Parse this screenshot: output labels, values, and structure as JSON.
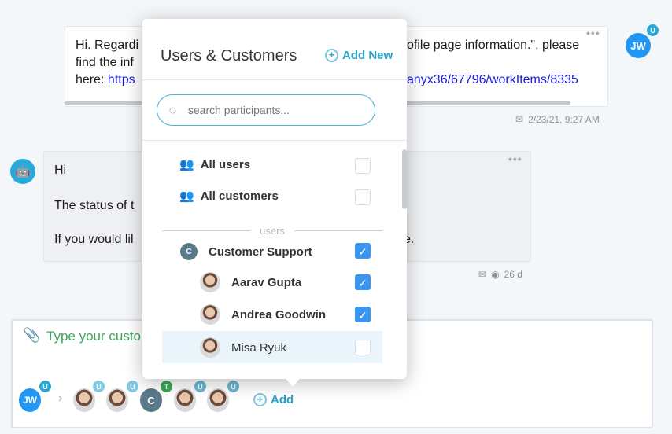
{
  "messages": [
    {
      "lines_left": [
        "Hi. Regardi",
        "find the inf",
        "here: "
      ],
      "link_left": "https",
      "lines_right": [
        "ofile page information.\", please",
        "",
        "anyx36/67796/workItems/8335"
      ],
      "timestamp": "2/23/21, 9:27 AM",
      "avatar": "JW",
      "badge": "U"
    },
    {
      "lines_left": [
        "Hi",
        "The status of t",
        "If you would lil"
      ],
      "right_fragment": "e.",
      "age": "26 d"
    }
  ],
  "composer": {
    "placeholder": "Type your custo",
    "participants": [
      {
        "initials": "JW",
        "badge": "U"
      },
      {
        "badge": "U"
      },
      {
        "badge": "U"
      },
      {
        "initials": "C",
        "badge": "T"
      },
      {
        "badge": "U"
      },
      {
        "badge": "U"
      }
    ],
    "add_label": "Add"
  },
  "popup": {
    "title": "Users & Customers",
    "add_new": "Add New",
    "search_placeholder": "search participants...",
    "all_users": "All users",
    "all_customers": "All customers",
    "section": "users",
    "group": {
      "initial": "C",
      "name": "Customer Support",
      "checked": true
    },
    "members": [
      {
        "name": "Aarav Gupta",
        "checked": true
      },
      {
        "name": "Andrea Goodwin",
        "checked": true
      },
      {
        "name": "Misa Ryuk",
        "checked": false
      }
    ]
  },
  "colors": {
    "accent": "#29a2c8",
    "check": "#3b95f0",
    "placeholder": "#3aa757"
  }
}
